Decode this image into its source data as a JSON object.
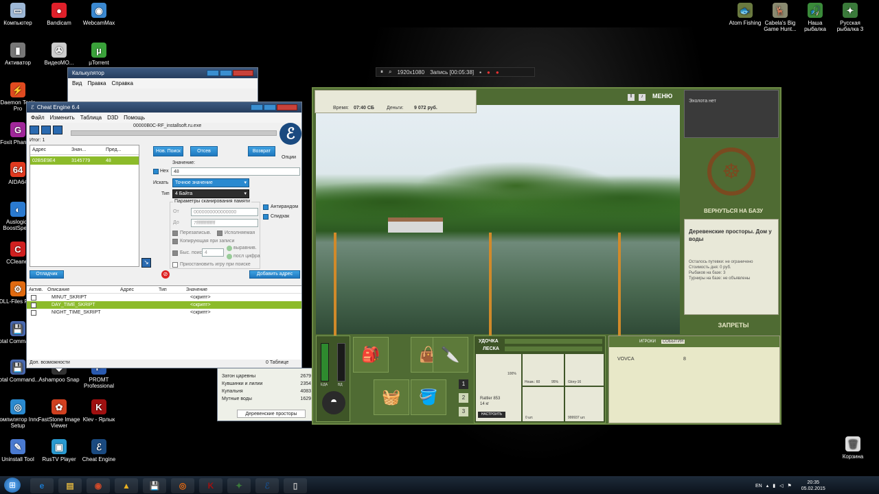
{
  "desktop_left": [
    {
      "label": "Компьютер",
      "icon": "computer-icon",
      "glyph": "▭",
      "color": "#9db7d5"
    },
    {
      "label": "Bandicam",
      "icon": "bandicam-icon",
      "glyph": "●",
      "color": "#e0202a"
    },
    {
      "label": "WebcamMax",
      "icon": "webcammax-icon",
      "glyph": "◉",
      "color": "#3a88d0"
    },
    {
      "label": "Активатор",
      "icon": "activator-icon",
      "glyph": "▮",
      "color": "#777"
    },
    {
      "label": "ВидеоМО...",
      "icon": "video-icon",
      "glyph": "✇",
      "color": "#ccc"
    },
    {
      "label": "µTorrent",
      "icon": "utorrent-icon",
      "glyph": "µ",
      "color": "#3aa23a"
    },
    {
      "label": "Daemon Tools Pro",
      "icon": "daemon-tools-icon",
      "glyph": "⚡",
      "color": "#e04a20"
    },
    {
      "label": "Foxit Phantom",
      "icon": "foxit-icon",
      "glyph": "G",
      "color": "#a0279a"
    },
    {
      "label": "AIDA64",
      "icon": "aida64-icon",
      "glyph": "64",
      "color": "#e03a20"
    },
    {
      "label": "Auslogics BoostSpeed",
      "icon": "auslogics-icon",
      "glyph": "◐",
      "color": "#2a7ad0"
    },
    {
      "label": "CCleaner",
      "icon": "ccleaner-icon",
      "glyph": "C",
      "color": "#d02020"
    },
    {
      "label": "DLL-Files Fixer",
      "icon": "dll-fixer-icon",
      "glyph": "⚙",
      "color": "#e06a10"
    },
    {
      "label": "Total Commander",
      "icon": "total-commander-icon",
      "glyph": "💾",
      "color": "#4a6ab0"
    },
    {
      "label": "Total Command...",
      "icon": "total-commander-2-icon",
      "glyph": "💾",
      "color": "#4a6ab0"
    },
    {
      "label": "Ashampoo Snap",
      "icon": "ashampoo-icon",
      "glyph": "◆",
      "color": "#333"
    },
    {
      "label": "PROMT Professional",
      "icon": "promt-icon",
      "glyph": "P",
      "color": "#2a5ab0"
    },
    {
      "label": "Компилятор Inno Setup",
      "icon": "inno-setup-icon",
      "glyph": "◎",
      "color": "#2a8ad0"
    },
    {
      "label": "FastStone Image Viewer",
      "icon": "faststone-icon",
      "glyph": "✿",
      "color": "#d04020"
    },
    {
      "label": "Klev - Ярлык",
      "icon": "klev-icon",
      "glyph": "K",
      "color": "#a01010"
    },
    {
      "label": "Uninstall Tool",
      "icon": "uninstall-tool-icon",
      "glyph": "✎",
      "color": "#4a7ad0"
    },
    {
      "label": "RusTV Player",
      "icon": "rustv-icon",
      "glyph": "▣",
      "color": "#2a9ad0"
    },
    {
      "label": "Cheat Engine",
      "icon": "cheat-engine-desk-icon",
      "glyph": "ℰ",
      "color": "#1a4a80"
    }
  ],
  "desktop_right": [
    {
      "label": "Atom Fishing",
      "icon": "atom-fishing-icon",
      "glyph": "🐟",
      "color": "#6a7a40"
    },
    {
      "label": "Cabela's Big Game Hunt...",
      "icon": "cabelas-icon",
      "glyph": "🦌",
      "color": "#8a8a70"
    },
    {
      "label": "Наша рыбалка",
      "icon": "nasha-rybalka-icon",
      "glyph": "🎣",
      "color": "#3a8a3a"
    },
    {
      "label": "Русская рыбалка 3",
      "icon": "russian-fishing-icon",
      "glyph": "✦",
      "color": "#3a7a3a"
    }
  ],
  "recycle_bin": "Корзина",
  "bandicam_bar": {
    "resolution": "1920x1080",
    "record": "Запись [00:05:38]"
  },
  "calculator": {
    "title": "Калькулятор",
    "menu": [
      "Вид",
      "Правка",
      "Справка"
    ]
  },
  "cheat_engine": {
    "title": "Cheat Engine 6.4",
    "menu": [
      "Файл",
      "Изменить",
      "Таблица",
      "D3D",
      "Помощь"
    ],
    "process": "00000B0C-RF_installsoft.ru.exe",
    "found": "Итог: 1",
    "list_headers": [
      "Адрес",
      "Знач...",
      "Пред..."
    ],
    "list_row": {
      "address": "02B5E9E4",
      "value": "3145779",
      "prev": "48"
    },
    "btn_new_scan": "Нов. Поиск",
    "btn_next_scan": "Отсев",
    "btn_undo": "Возврат",
    "options": "Опции",
    "value_label": "Значение:",
    "hex_label": "Hex",
    "value_input": "48",
    "scan_type_label": "Искать",
    "scan_type": "Точное значение",
    "value_type_label": "Тип",
    "value_type": "4 Байта",
    "mem_group": "Параметры сканирования памяти",
    "from_label": "От",
    "from_value": "0000000000000000",
    "to_label": "До",
    "to_value": "7fffffffffffffff",
    "writable": "Перезаписыв.",
    "executable": "Исполняемая",
    "copy_on_write": "Копирующая при записи",
    "fast_scan": "Быс. поиск",
    "fast_scan_value": "4",
    "alignment": "выравнив.",
    "last_digits": "посл цифра",
    "pause_game": "Приостановить игру при поиске",
    "antirandom": "Антирандом",
    "speedhack": "Спидхак",
    "memory_view": "Отладчик",
    "add_address": "Добавить адрес",
    "table_headers": [
      "Актив.",
      "Описание",
      "Адрес",
      "Тип",
      "Значение"
    ],
    "table_rows": [
      {
        "desc": "MINUT_SKRIPT",
        "value": "<скрипт>"
      },
      {
        "desc": "DAY_TIME_SKRIPT",
        "value": "<скрипт>"
      },
      {
        "desc": "NIGHT_TIME_SKRIPT",
        "value": "<скрипт>"
      }
    ],
    "footer_left": "Доп. возможности",
    "footer_right": "0 Таблице"
  },
  "side_list": {
    "items": [
      {
        "name": "Затон царевны",
        "value": "2679"
      },
      {
        "name": "Кувшинки и лилии",
        "value": "2354"
      },
      {
        "name": "Купальня",
        "value": "4083"
      },
      {
        "name": "Мутные воды",
        "value": "1629"
      }
    ],
    "tab": "Деревенские просторы"
  },
  "game": {
    "time_label": "Время:",
    "time": "07:40 СБ",
    "money_label": "Деньги:",
    "money": "9 072 руб.",
    "menu": "МЕНЮ",
    "sonar": "Эхолота нет",
    "return_base": "ВЕРНУТЬСЯ НА БАЗУ",
    "location_title": "Деревенские просторы. Дом у воды",
    "info": [
      "Осталось путевки: не ограничено",
      "Стоимость дня: 0 руб.",
      "Рыбаков на базе: 3",
      "Турниры на базе: не объявлены"
    ],
    "bans": "ЗАПРЕТЫ",
    "rod_label": "УДОЧКА",
    "line_label": "ЛЕСКА",
    "rod_name": "Rattler 853",
    "rod_weight": "14 кг",
    "rod_percent": "100%",
    "setup": "НАСТРОИТЬ",
    "reel_label": "Ноuм.: 60",
    "reel_percent": "95%",
    "line_name": "Glory-16",
    "hook_count": "0 шт.",
    "bait_count": "999937 шт.",
    "food_label": "ЕДА",
    "water_label": "ВД",
    "slots": [
      "1",
      "2",
      "3"
    ],
    "tabs": [
      "ИГРОКИ",
      "СОБЫТИЯ"
    ],
    "player": {
      "name": "VOVCA",
      "value": "8"
    }
  },
  "taskbar": {
    "lang": "EN",
    "time": "20:35",
    "date": "05.02.2015"
  }
}
